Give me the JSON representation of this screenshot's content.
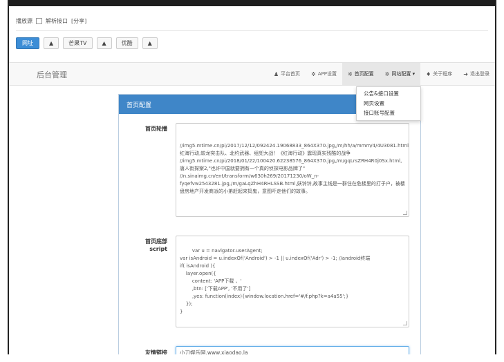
{
  "source_bar": {
    "label": "播放源",
    "parse_checkbox": "解析接口",
    "share": "[分享]"
  },
  "button_row": {
    "primary": "网址",
    "btn2": "芒果TV",
    "btn3": "优酷",
    "arrow": "▲"
  },
  "navbar": {
    "brand": "后台管理",
    "items": [
      {
        "icon": "user-icon",
        "glyph": "♟",
        "label": "平台首页"
      },
      {
        "icon": "gear-icon",
        "glyph": "✲",
        "label": "APP设置"
      },
      {
        "icon": "gear-icon",
        "glyph": "✲",
        "label": "首页配置"
      },
      {
        "icon": "gear-icon",
        "glyph": "✲",
        "label": "网站配置 ▾"
      },
      {
        "icon": "pin-icon",
        "glyph": "♦",
        "label": "关于程序"
      },
      {
        "icon": "logout-icon",
        "glyph": "➜",
        "label": "退出登录"
      }
    ]
  },
  "dropdown": {
    "items": [
      "公告&接口设置",
      "网页设置",
      "接口账号配置"
    ]
  },
  "panel": {
    "title": "首页配置",
    "carousel_label": "首页轮播",
    "carousel_value": "//img5.mtime.cn/pi/2017/12/12/092424.19068833_864X370.jpg,/m/hh/a/mmm/4/4U3081.html,红海行动,蛟龙突击队、北约武器、组兜大战！《红海行动》震现真实残酷的战争\n//img5.mtime.cn/pi/2018/01/22/100420.62238576_864X370.jpg,/m/gqLrsZRH4R0j0Sx.html,唐人街探案2,\"也许中国就要拥有一个真的侦探电影品牌了\"\n//n.sinaimg.cn/ent/transform/w630h269/20171230/oW_n-fyqefvw2543281.jpg,/m/gaLqZhH4RHLSSB.html,妖铃铃,故事主线是一群住在危楼里的打子户，被楼盘房地产开发商派的小弟赶起来捣鬼，意图吓走他们的故事。",
    "footer_label_line1": "首页底部",
    "footer_label_line2": "script",
    "footer_value": "var u = navigator.userAgent;\nvar isAndroid = u.indexOf('Android') > -1 || u.indexOf('Adr') > -1; //android终端\nif( isAndroid ){\n    layer.open({\n        content: 'APP下载 、'\n        ,btn: ['下载APP', '不用了']\n        ,yes: function(index){window.location.href='#/f.php?k=a4a55';}\n    });\n}",
    "link_label": "友情链接",
    "link_value": "小刀娱乐网,www.xiaodao.la"
  },
  "colors": {
    "accent": "#3f86c8",
    "primary_button": "#3c8dd6"
  }
}
